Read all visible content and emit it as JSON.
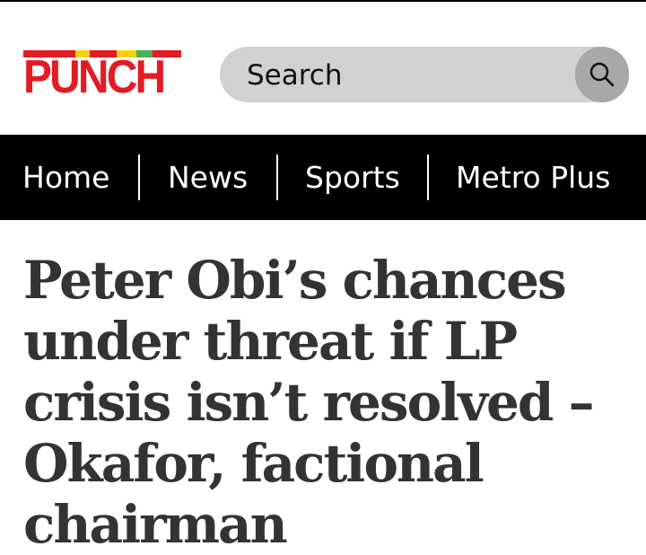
{
  "logo": {
    "text": "PUNCH",
    "colors": {
      "text": "#e31b23",
      "stripe": [
        "#e31b23",
        "#f7d117",
        "#4caf50"
      ]
    }
  },
  "search": {
    "placeholder": "Search",
    "icon": "search-icon"
  },
  "nav": {
    "items": [
      {
        "label": "Home"
      },
      {
        "label": "News"
      },
      {
        "label": "Sports"
      },
      {
        "label": "Metro Plus"
      }
    ]
  },
  "article": {
    "headline": "Peter Obi’s chances under threat if LP crisis isn’t resolved – Okafor, factional chairman"
  }
}
